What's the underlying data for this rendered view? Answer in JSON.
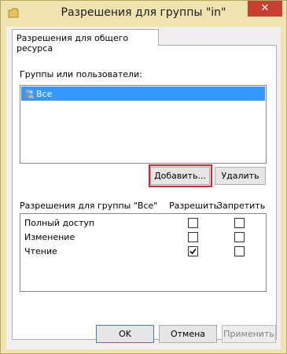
{
  "window": {
    "title": "Разрешения для группы \"in\"",
    "close_glyph": "✕"
  },
  "tab": {
    "label": "Разрешения для общего ресурса"
  },
  "groups": {
    "label": "Группы или пользователи:",
    "items": [
      {
        "label": "Все",
        "icon": "users-icon",
        "selected": true
      }
    ]
  },
  "buttons": {
    "add": "Добавить...",
    "remove": "Удалить",
    "ok": "OK",
    "cancel": "Отмена",
    "apply": "Применить"
  },
  "permissions": {
    "header": "Разрешения для группы \"Все\"",
    "allow_header": "Разрешить",
    "deny_header": "Запретить",
    "rows": [
      {
        "label": "Полный доступ",
        "allow": false,
        "deny": false
      },
      {
        "label": "Изменение",
        "allow": false,
        "deny": false
      },
      {
        "label": "Чтение",
        "allow": true,
        "deny": false
      }
    ]
  },
  "colors": {
    "frame": "#efe4b0",
    "close": "#c84031",
    "selection": "#3399ff",
    "highlight": "#e0202a"
  }
}
